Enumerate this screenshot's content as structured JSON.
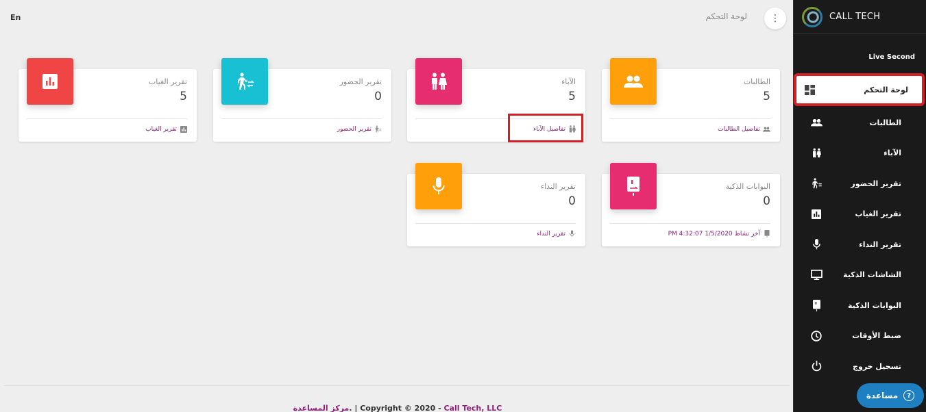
{
  "topbar": {
    "lang": "En",
    "title": "لوحة التحكم"
  },
  "sidebar": {
    "brand": "CALL TECH",
    "live_second": "Live Second",
    "items": [
      {
        "label": "لوحة التحكم",
        "icon": "dashboard-icon",
        "active": true
      },
      {
        "label": "الطالبات",
        "icon": "group-icon"
      },
      {
        "label": "الآباء",
        "icon": "parents-icon"
      },
      {
        "label": "تقرير الحضور",
        "icon": "walking-icon"
      },
      {
        "label": "تقرير الغياب",
        "icon": "chart-icon"
      },
      {
        "label": "تقرير النداء",
        "icon": "microphone-icon"
      },
      {
        "label": "الشاشات الذكية",
        "icon": "monitor-icon"
      },
      {
        "label": "البوابات الذكية",
        "icon": "gate-icon"
      },
      {
        "label": "ضبط الأوقات",
        "icon": "clock-icon"
      },
      {
        "label": "تسجيل خروج",
        "icon": "power-icon"
      }
    ],
    "help_label": "مساعدة"
  },
  "cards": [
    {
      "title": "الطالبات",
      "value": "5",
      "footer": "تفاصيل الطالبات",
      "color": "#ff9f0a",
      "icon": "group-icon"
    },
    {
      "title": "الآباء",
      "value": "5",
      "footer": "تفاصيل الآباء",
      "color": "#e62d6f",
      "icon": "parents-icon"
    },
    {
      "title": "تقرير الحضور",
      "value": "0",
      "footer": "تقرير الحضور",
      "color": "#17c0d3",
      "icon": "walking-icon"
    },
    {
      "title": "تقرير الغياب",
      "value": "5",
      "footer": "تقرير الغياب",
      "color": "#ef4545",
      "icon": "chart-icon"
    },
    {
      "title": "البوابات الذكية",
      "value": "0",
      "footer": "آخر نشاط 1/5/2020 4:32:07 PM",
      "color": "#e62d6f",
      "icon": "gate-icon"
    },
    {
      "title": "تقرير النداء",
      "value": "0",
      "footer": "تقرير النداء",
      "color": "#ff9f0a",
      "icon": "microphone-icon"
    }
  ],
  "footer": {
    "prefix": "Copyright © 2020 - ",
    "company": "Call Tech, LLC",
    "separator": ". | ",
    "help_center": "مركز المساعدة"
  }
}
